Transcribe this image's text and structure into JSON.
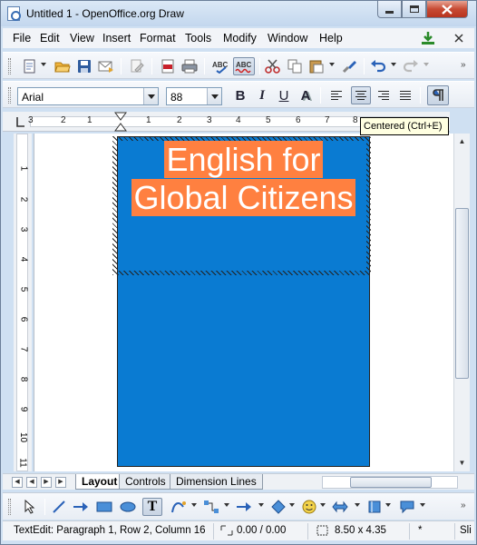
{
  "window": {
    "title": "Untitled 1 - OpenOffice.org Draw",
    "controls": [
      "minimize-icon",
      "maximize-icon",
      "close-icon"
    ]
  },
  "menubar": {
    "items": [
      "File",
      "Edit",
      "View",
      "Insert",
      "Format",
      "Tools",
      "Modify",
      "Window",
      "Help"
    ]
  },
  "standard_toolbar": {
    "icons": [
      "new-icon",
      "open-folder-icon",
      "save-icon",
      "email-icon",
      "edit-file-icon",
      "export-pdf-icon",
      "print-icon",
      "spellcheck-icon",
      "autospellcheck-icon",
      "cut-icon",
      "copy-icon",
      "paste-icon",
      "clone-format-icon",
      "undo-icon",
      "redo-icon"
    ]
  },
  "formatting_toolbar": {
    "font_name": "Arial",
    "font_size": "88",
    "bold": "B",
    "italic": "I",
    "underline": "U",
    "shadow": "A",
    "align_active": "center"
  },
  "tooltip": {
    "text": "Centered (Ctrl+E)"
  },
  "ruler": {
    "h_labels": [
      "3",
      "2",
      "1",
      "1",
      "2",
      "3",
      "4",
      "5",
      "6",
      "7",
      "8"
    ],
    "v_labels": [
      "1",
      "2",
      "3",
      "4",
      "5",
      "6",
      "7",
      "8",
      "9",
      "10",
      "11"
    ]
  },
  "document": {
    "line1": "English for",
    "line2": "Global Citizens",
    "page_color": "#0a7bd2",
    "highlight_color": "#ff8040",
    "text_color": "#ffffff"
  },
  "tabs": {
    "items": [
      "Layout",
      "Controls",
      "Dimension Lines"
    ],
    "active": "Layout"
  },
  "drawing_toolbar": {
    "icons": [
      "select-icon",
      "line-icon",
      "arrow-line-icon",
      "rectangle-icon",
      "ellipse-icon",
      "text-icon",
      "curve-icon",
      "connector-icon",
      "lines-arrows-icon",
      "basic-shapes-icon",
      "symbol-shapes-icon",
      "block-arrows-icon",
      "flowcharts-icon",
      "callouts-icon"
    ]
  },
  "statusbar": {
    "text_edit": "TextEdit: Paragraph 1, Row 2, Column 16",
    "position": "0.00 / 0.00",
    "size": "8.50 x 4.35",
    "modified": "*",
    "signature": "Sli"
  }
}
